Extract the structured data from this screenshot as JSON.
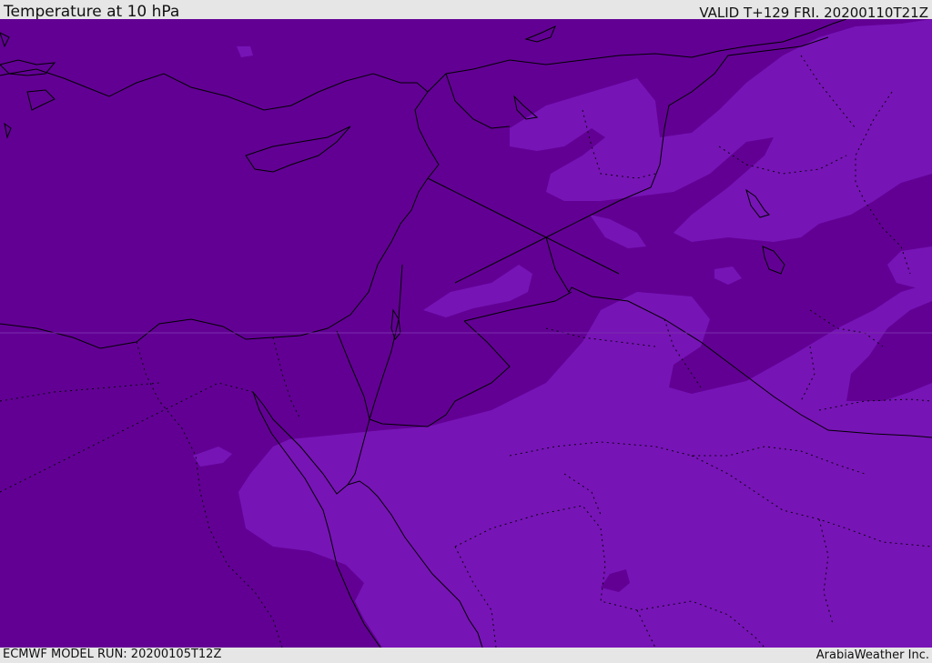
{
  "header": {
    "title": "Temperature at 10 hPa",
    "valid_time": "VALID T+129 FRI. 20200110T21Z"
  },
  "footer": {
    "model_run": "ECMWF MODEL RUN: 20200105T12Z",
    "credit": "ArabiaWeather Inc."
  },
  "map": {
    "field": "temperature",
    "colors": {
      "band_cold": "#620094",
      "band_mid": "#7714b6",
      "border": "#000000"
    }
  }
}
